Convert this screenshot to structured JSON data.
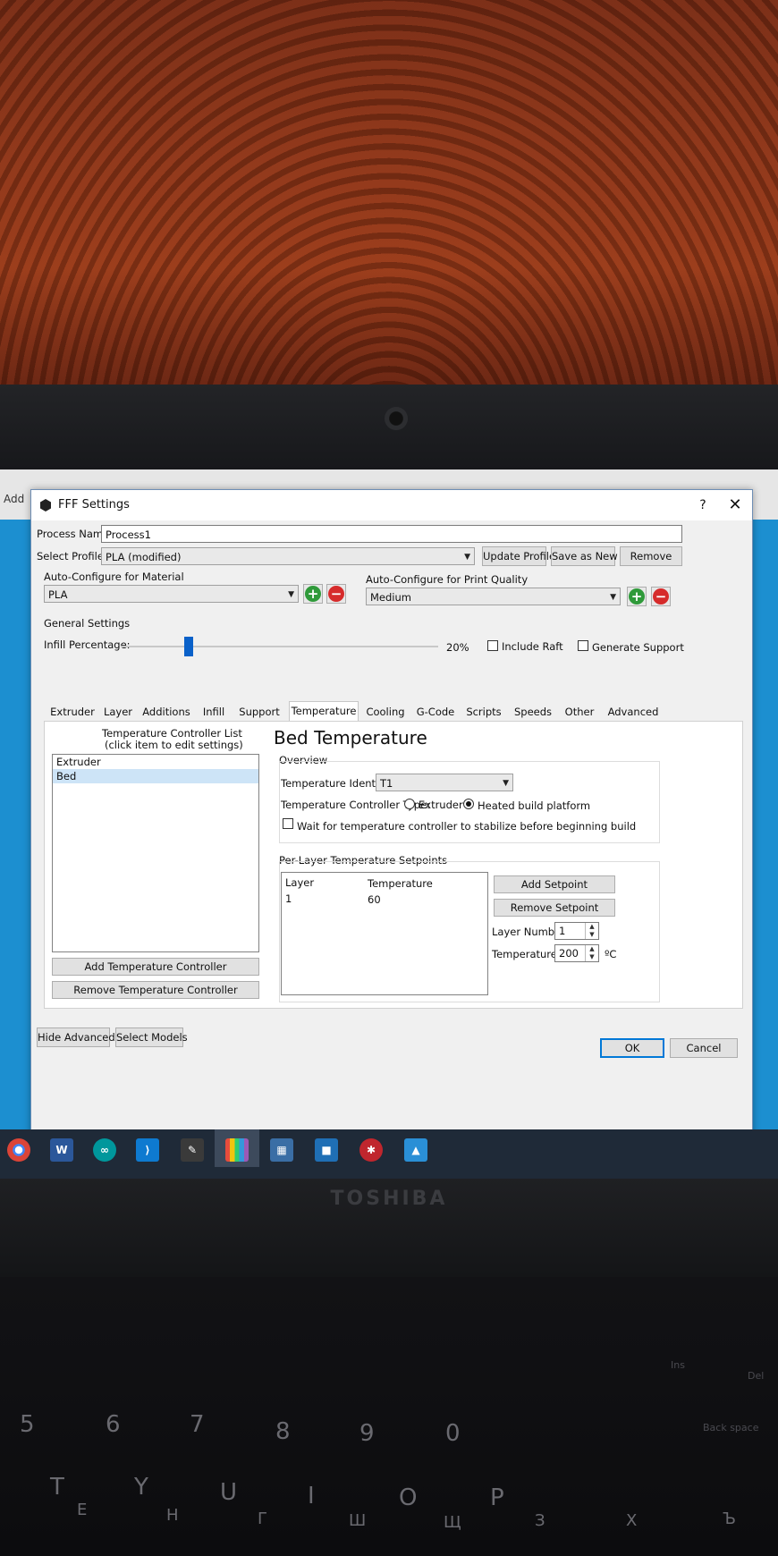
{
  "background_app": {
    "label": "Add"
  },
  "dialog": {
    "title": "FFF Settings",
    "help_label": "?",
    "close_label": "✕",
    "process_name_label": "Process Name:",
    "process_name_value": "Process1",
    "select_profile_label": "Select Profile:",
    "select_profile_value": "PLA (modified)",
    "update_profile_label": "Update Profile",
    "save_as_new_label": "Save as New",
    "remove_label": "Remove",
    "auto_material_label": "Auto-Configure for Material",
    "material_value": "PLA",
    "auto_quality_label": "Auto-Configure for Print Quality",
    "quality_value": "Medium",
    "general_settings_label": "General Settings",
    "infill_label": "Infill Percentage:",
    "infill_value": "20%",
    "infill_fraction": 0.2,
    "include_raft_label": "Include Raft",
    "include_raft_checked": false,
    "generate_support_label": "Generate Support",
    "generate_support_checked": false,
    "tabs": [
      "Extruder",
      "Layer",
      "Additions",
      "Infill",
      "Support",
      "Temperature",
      "Cooling",
      "G-Code",
      "Scripts",
      "Speeds",
      "Other",
      "Advanced"
    ],
    "active_tab": "Temperature",
    "temperature": {
      "controller_list_title": "Temperature Controller List",
      "controller_list_subtitle": "(click item to edit settings)",
      "controllers": [
        "Extruder",
        "Bed"
      ],
      "selected_controller": "Bed",
      "add_controller_label": "Add Temperature Controller",
      "remove_controller_label": "Remove Temperature Controller",
      "heading": "Bed Temperature",
      "overview_label": "Overview",
      "identifier_label": "Temperature Identifier",
      "identifier_value": "T1",
      "controller_type_label": "Temperature Controller Type:",
      "type_extruder_label": "Extruder",
      "type_bed_label": "Heated build platform",
      "selected_type": "Heated build platform",
      "wait_label": "Wait for temperature controller to stabilize before beginning build",
      "wait_checked": false,
      "setpoints_label": "Per-Layer Temperature Setpoints",
      "setpoint_columns": [
        "Layer",
        "Temperature"
      ],
      "setpoints": [
        {
          "layer": "1",
          "temperature": "60"
        }
      ],
      "add_setpoint_label": "Add Setpoint",
      "remove_setpoint_label": "Remove Setpoint",
      "layer_number_label": "Layer Number",
      "layer_number_value": "1",
      "temperature_label": "Temperature",
      "temperature_value": "200",
      "temperature_unit": "ºC"
    },
    "hide_advanced_label": "Hide Advanced",
    "select_models_label": "Select Models",
    "ok_label": "OK",
    "cancel_label": "Cancel"
  },
  "taskbar": {
    "icons": [
      "chrome-icon",
      "word-icon",
      "arduino-icon",
      "vscode-icon",
      "inkscape-icon",
      "simplify3d-icon",
      "calculator-icon",
      "app-icon",
      "antivirus-icon",
      "photos-icon"
    ]
  },
  "laptop": {
    "brand": "TOSHIBA",
    "keys": {
      "row1": [
        "Ins",
        "Del"
      ],
      "row2": [
        "5",
        "6",
        "7",
        "8",
        "9",
        "0",
        "Back space"
      ],
      "row3": [
        "T",
        "Y",
        "U",
        "I",
        "O",
        "P"
      ],
      "cyr": [
        "Е",
        "Н",
        "Г",
        "Ш",
        "Щ",
        "З",
        "Х",
        "Ъ"
      ]
    }
  },
  "colors": {
    "accent": "#0078d7",
    "desktop": "#1c8fd0",
    "selection": "#cde4f7",
    "taskbar": "#1f2a38"
  }
}
